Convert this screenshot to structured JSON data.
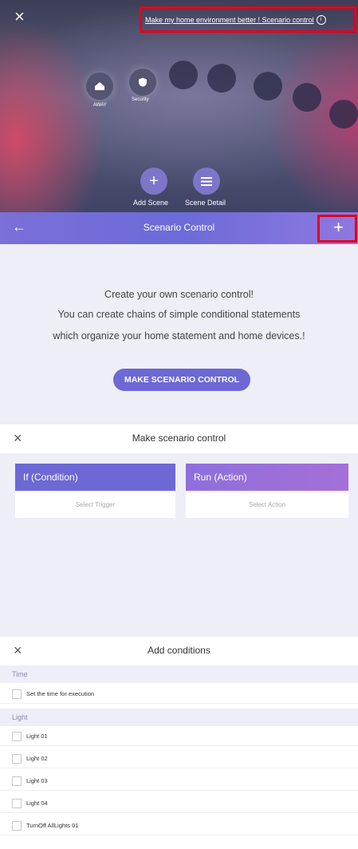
{
  "home": {
    "top_link": "Make my home environment better ! Scenario control",
    "info_icon": "i",
    "orb_labels": [
      "AWAY",
      "Security"
    ],
    "add_scene_icon": "+",
    "add_scene": "Add Scene",
    "scene_detail": "Scene Detail",
    "close_icon": "×"
  },
  "scenario": {
    "title": "Scenario Control",
    "back_icon": "←",
    "plus_icon": "+",
    "desc": [
      "Create your own scenario control!",
      "You can create chains of simple conditional statements",
      "which organize your home statement and home devices.!"
    ],
    "button": "MAKE SCENARIO CONTROL"
  },
  "make": {
    "title": "Make scenario control",
    "close_icon": "×",
    "condition": {
      "head": "If (Condition)",
      "body": "Select Trigger"
    },
    "action": {
      "head": "Run (Action)",
      "body": "Select Action"
    }
  },
  "conditions": {
    "title": "Add conditions",
    "close_icon": "×",
    "time_label": "Time",
    "time_item": "Set the time for execution",
    "light_label": "Light",
    "light_items": [
      "Light 01",
      "Light 02",
      "Light 03",
      "Light 04",
      "TurnOff AllLights 01"
    ]
  },
  "colors": {
    "accent": "#6c6bd8",
    "highlight": "#e3001b",
    "action_head": "#9b6fdc"
  }
}
